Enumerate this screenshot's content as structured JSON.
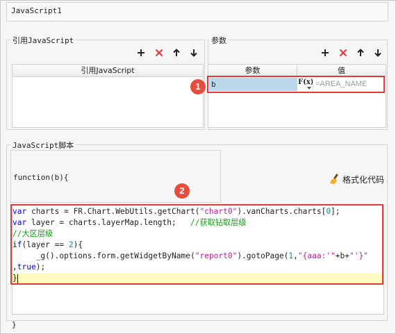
{
  "window": {
    "title": "JavaScript1"
  },
  "ref_js": {
    "legend": "引用JavaScript",
    "column": "引用JavaScript"
  },
  "params": {
    "legend": "参数",
    "columns": [
      "参数",
      "值"
    ],
    "row": {
      "name": "b",
      "fx": "F(x)",
      "value": "=AREA_NAME"
    }
  },
  "script": {
    "legend": "JavaScript脚本",
    "signature": "function(b){",
    "format_label": "格式化代码",
    "closing": "}",
    "lines": [
      [
        [
          "kw",
          "var"
        ],
        [
          "txt",
          " charts = FR.Chart.WebUtils.getChart("
        ],
        [
          "str",
          "\"chart0\""
        ],
        [
          "txt",
          ").vanCharts.charts["
        ],
        [
          "num",
          "0"
        ],
        [
          "txt",
          "];"
        ]
      ],
      [
        [
          "kw",
          "var"
        ],
        [
          "txt",
          " layer = charts.layerMap.length;   "
        ],
        [
          "cm",
          "//获取钻取层级"
        ]
      ],
      [
        [
          "cm",
          "//大区层级"
        ]
      ],
      [
        [
          "kw",
          "if"
        ],
        [
          "txt",
          "(layer == "
        ],
        [
          "num",
          "2"
        ],
        [
          "txt",
          "){"
        ]
      ],
      [
        [
          "txt",
          "     _g().options.form.getWidgetByName("
        ],
        [
          "str",
          "\"report0\""
        ],
        [
          "txt",
          ").gotoPage("
        ],
        [
          "num",
          "1"
        ],
        [
          "txt",
          ","
        ],
        [
          "str",
          "\"{aaa:'\""
        ],
        [
          "txt",
          "+b+"
        ],
        [
          "str",
          "\"'}\""
        ]
      ],
      [
        [
          "txt",
          ","
        ],
        [
          "kw",
          "true"
        ],
        [
          "txt",
          ");"
        ]
      ],
      [
        [
          "txt",
          "}"
        ]
      ]
    ]
  },
  "badges": [
    "1",
    "2"
  ],
  "colors": {
    "highlight": "#e53935",
    "badge": "#e84c3d",
    "keyword": "#0000ff",
    "string": "#c01a9b",
    "number": "#0c8b8b",
    "comment": "#14a014"
  }
}
